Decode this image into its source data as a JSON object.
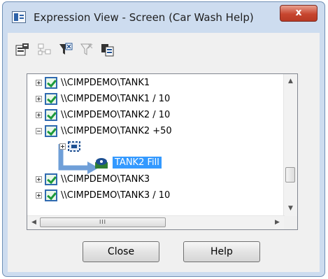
{
  "window": {
    "title": "Expression View - Screen (Car Wash Help)",
    "close_glyph": "x",
    "frame_color": "#cddcef"
  },
  "toolbar": {
    "buttons": [
      {
        "icon": "properties-icon",
        "enabled": true
      },
      {
        "icon": "tree-structure-icon",
        "enabled": false
      },
      {
        "icon": "filter-icon",
        "enabled": true
      },
      {
        "icon": "filter-clear-icon",
        "enabled": false
      },
      {
        "icon": "copy-icon",
        "enabled": true
      }
    ]
  },
  "tree": {
    "nodes": [
      {
        "label": "\\\\CIMPDEMO\\TANK1",
        "expander": "plus",
        "checked": true
      },
      {
        "label": "\\\\CIMPDEMO\\TANK1 / 10",
        "expander": "plus",
        "checked": true
      },
      {
        "label": "\\\\CIMPDEMO\\TANK2 / 10",
        "expander": "plus",
        "checked": true
      },
      {
        "label": "\\\\CIMPDEMO\\TANK2 +50",
        "expander": "minus",
        "checked": true
      },
      {
        "label": "",
        "expander": "plus",
        "icon": "screen-object-icon"
      },
      {
        "label": "TANK2 Fill",
        "icon": "fill-animation-icon",
        "selected": true
      },
      {
        "label": "\\\\CIMPDEMO\\TANK3",
        "expander": "plus",
        "checked": true
      },
      {
        "label": "\\\\CIMPDEMO\\TANK3 / 10",
        "expander": "plus",
        "checked": true
      }
    ],
    "selection_color": "#3399ff",
    "checkbox_color": "#2f6ab0",
    "vscroll_position": 0.78,
    "hscroll_position": 0.0,
    "hscroll_thumb_grip": "III"
  },
  "buttons": {
    "close_label": "Close",
    "help_label": "Help"
  }
}
